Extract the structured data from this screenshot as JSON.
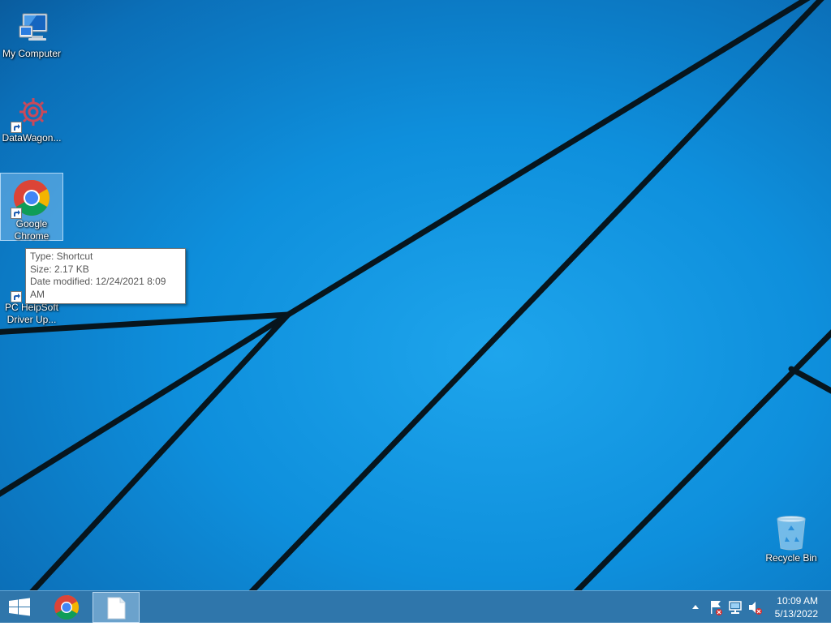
{
  "desktop": {
    "icons": [
      {
        "label": "My Computer"
      },
      {
        "label": "DataWagon..."
      },
      {
        "label": "Google\nChrome"
      },
      {
        "label": "PC HelpSoft\nDriver Up..."
      },
      {
        "label": "Recycle Bin"
      }
    ],
    "tooltip": {
      "line1": "Type: Shortcut",
      "line2": "Size: 2.17 KB",
      "line3": "Date modified: 12/24/2021 8:09 AM"
    }
  },
  "taskbar": {
    "clock": {
      "time": "10:09 AM",
      "date": "5/13/2022"
    }
  },
  "colors": {
    "wallpaper": "#0e8fdc",
    "taskbar": "#2670a8",
    "wall_lines": "#08161e"
  }
}
